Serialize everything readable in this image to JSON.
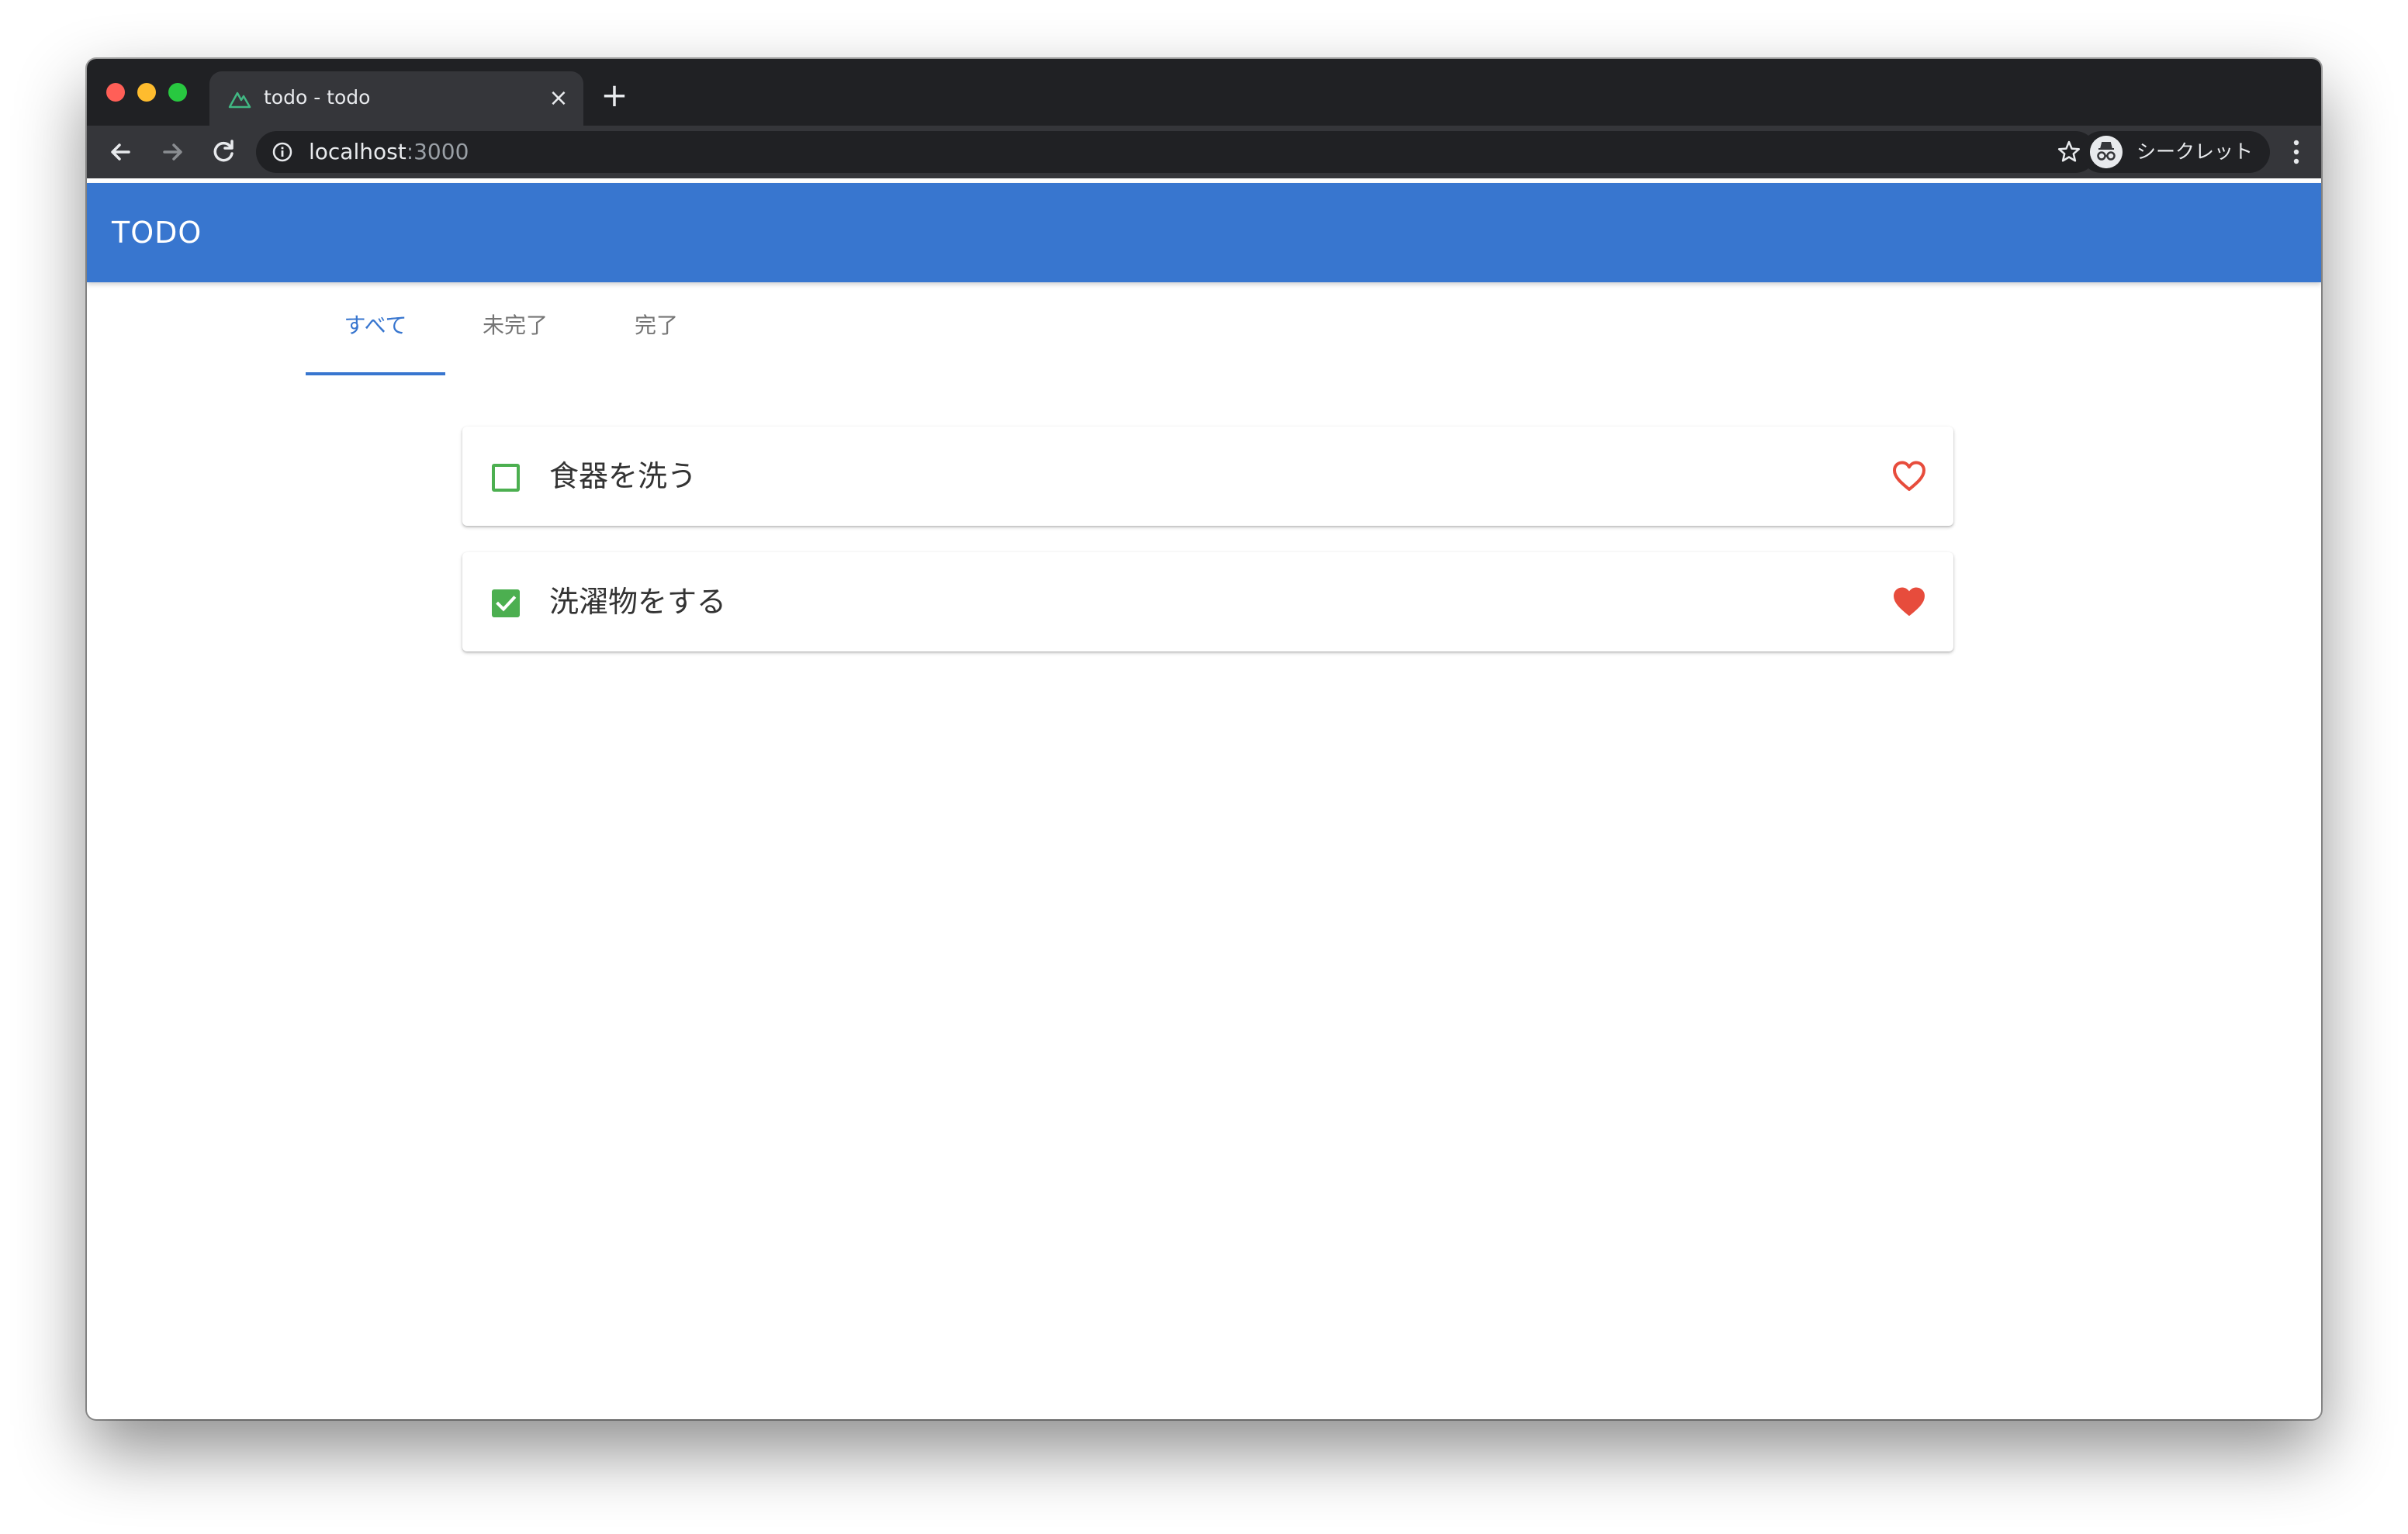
{
  "browser": {
    "tab_title": "todo - todo",
    "tab_close_icon": "close-icon",
    "new_tab_icon": "plus-icon",
    "url_host": "localhost",
    "url_port": ":3000",
    "incognito_label": "シークレット"
  },
  "app": {
    "title": "TODO",
    "header_color": "#3876cf",
    "filter_tabs": [
      {
        "label": "すべて",
        "active": true
      },
      {
        "label": "未完了",
        "active": false
      },
      {
        "label": "完了",
        "active": false
      }
    ],
    "todos": [
      {
        "text": "食器を洗う",
        "done": false,
        "favorite": false
      },
      {
        "text": "洗濯物をする",
        "done": true,
        "favorite": true
      }
    ],
    "check_color": "#4caf50",
    "heart_color": "#e74c3c"
  }
}
